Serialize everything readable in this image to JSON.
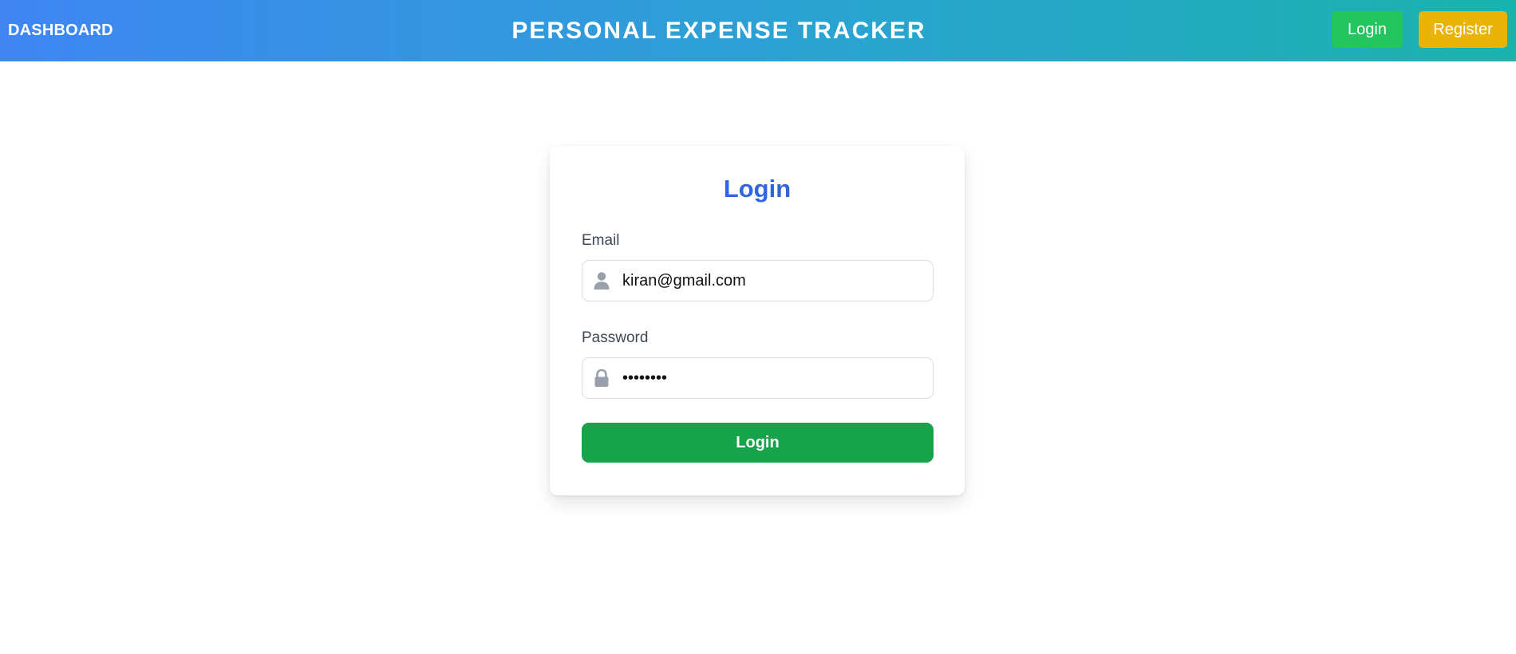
{
  "header": {
    "brand": "DASHBOARD",
    "title": "PERSONAL EXPENSE TRACKER",
    "login_label": "Login",
    "register_label": "Register"
  },
  "login_form": {
    "title": "Login",
    "email_label": "Email",
    "email_value": "kiran@gmail.com",
    "email_icon": "user-icon",
    "password_label": "Password",
    "password_value": "kiran123",
    "password_icon": "lock-icon",
    "submit_label": "Login"
  },
  "colors": {
    "header_gradient_start": "#3f86f3",
    "header_gradient_end": "#19b3ad",
    "nav_login": "#22c55e",
    "nav_register": "#eab308",
    "title_blue": "#2f66e0",
    "submit_green": "#16a34a"
  }
}
